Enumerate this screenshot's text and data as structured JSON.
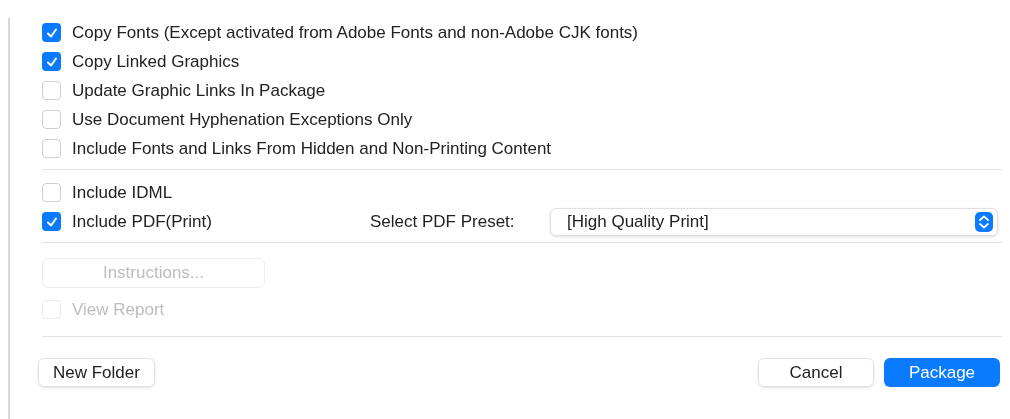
{
  "options": [
    {
      "label": "Copy Fonts (Except activated from Adobe Fonts and non-Adobe CJK fonts)",
      "checked": true
    },
    {
      "label": "Copy Linked Graphics",
      "checked": true
    },
    {
      "label": "Update Graphic Links In Package",
      "checked": false
    },
    {
      "label": "Use Document Hyphenation Exceptions Only",
      "checked": false
    },
    {
      "label": "Include Fonts and Links From Hidden and Non-Printing Content",
      "checked": false
    }
  ],
  "export_options": [
    {
      "label": "Include IDML",
      "checked": false
    },
    {
      "label": "Include PDF(Print)",
      "checked": true
    }
  ],
  "pdf_preset": {
    "label": "Select PDF Preset:",
    "value": "[High Quality Print]"
  },
  "instructions_button": {
    "label": "Instructions...",
    "disabled": true
  },
  "view_report": {
    "label": "View Report",
    "checked": false,
    "disabled": true
  },
  "buttons": {
    "left": "New Folder",
    "cancel": "Cancel",
    "primary": "Package"
  }
}
